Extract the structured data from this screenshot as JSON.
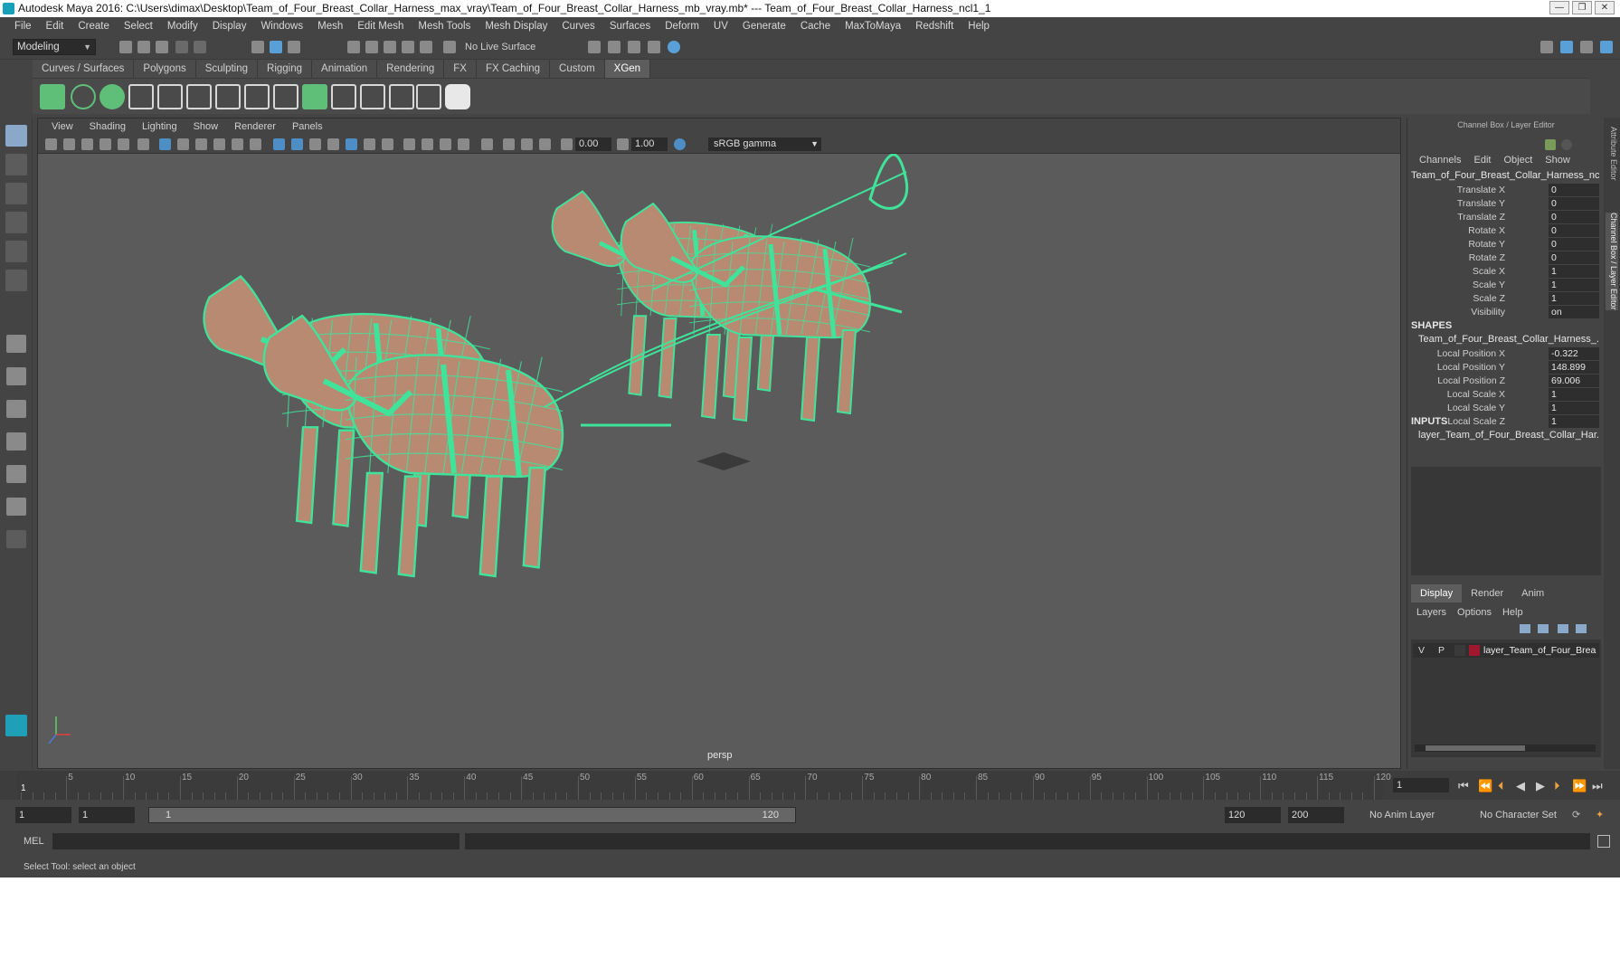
{
  "window": {
    "title": "Autodesk Maya 2016: C:\\Users\\dimax\\Desktop\\Team_of_Four_Breast_Collar_Harness_max_vray\\Team_of_Four_Breast_Collar_Harness_mb_vray.mb*   ---   Team_of_Four_Breast_Collar_Harness_ncl1_1",
    "buttons": [
      "—",
      "❐",
      "✕"
    ]
  },
  "menubar": [
    "File",
    "Edit",
    "Create",
    "Select",
    "Modify",
    "Display",
    "Windows",
    "Mesh",
    "Edit Mesh",
    "Mesh Tools",
    "Mesh Display",
    "Curves",
    "Surfaces",
    "Deform",
    "UV",
    "Generate",
    "Cache",
    "MaxToMaya",
    "Redshift",
    "Help"
  ],
  "statusline": {
    "mode": "Modeling",
    "live_surface": "No Live Surface"
  },
  "shelf": {
    "tabs": [
      "Curves / Surfaces",
      "Polygons",
      "Sculpting",
      "Rigging",
      "Animation",
      "Rendering",
      "FX",
      "FX Caching",
      "Custom",
      "XGen"
    ],
    "active_tab": "XGen"
  },
  "viewport": {
    "menu": [
      "View",
      "Shading",
      "Lighting",
      "Show",
      "Renderer",
      "Panels"
    ],
    "exposure": "0.00",
    "gamma": "1.00",
    "color_space": "sRGB gamma",
    "camera": "persp",
    "wire_color": "#3fe39a",
    "body_color": "#b98a72"
  },
  "channel_box": {
    "header": "Channel Box / Layer Editor",
    "menu": [
      "Channels",
      "Edit",
      "Object",
      "Show"
    ],
    "object_name": "Team_of_Four_Breast_Collar_Harness_ncl...",
    "channels": [
      {
        "label": "Translate X",
        "value": "0"
      },
      {
        "label": "Translate Y",
        "value": "0"
      },
      {
        "label": "Translate Z",
        "value": "0"
      },
      {
        "label": "Rotate X",
        "value": "0"
      },
      {
        "label": "Rotate Y",
        "value": "0"
      },
      {
        "label": "Rotate Z",
        "value": "0"
      },
      {
        "label": "Scale X",
        "value": "1"
      },
      {
        "label": "Scale Y",
        "value": "1"
      },
      {
        "label": "Scale Z",
        "value": "1"
      },
      {
        "label": "Visibility",
        "value": "on"
      }
    ],
    "shapes_title": "SHAPES",
    "shape_name": "Team_of_Four_Breast_Collar_Harness_...",
    "shape_channels": [
      {
        "label": "Local Position X",
        "value": "-0.322"
      },
      {
        "label": "Local Position Y",
        "value": "148.899"
      },
      {
        "label": "Local Position Z",
        "value": "69.006"
      },
      {
        "label": "Local Scale X",
        "value": "1"
      },
      {
        "label": "Local Scale Y",
        "value": "1"
      },
      {
        "label": "Local Scale Z",
        "value": "1"
      }
    ],
    "inputs_title": "INPUTS",
    "input_name": "layer_Team_of_Four_Breast_Collar_Har..."
  },
  "layer_editor": {
    "tabs": [
      "Display",
      "Render",
      "Anim"
    ],
    "active_tab": "Display",
    "menu": [
      "Layers",
      "Options",
      "Help"
    ],
    "layer": {
      "v": "V",
      "p": "P",
      "name": "layer_Team_of_Four_Brea",
      "color": "#a01830"
    }
  },
  "side_tabs": [
    "Attribute Editor",
    "Channel Box / Layer Editor"
  ],
  "timeline": {
    "ticks": [
      "5",
      "10",
      "15",
      "20",
      "25",
      "30",
      "35",
      "40",
      "45",
      "50",
      "55",
      "60",
      "65",
      "70",
      "75",
      "80",
      "85",
      "90",
      "95",
      "100",
      "105",
      "110",
      "115",
      "120"
    ],
    "current_frame_marker": "1",
    "current_frame": "1",
    "start": 1,
    "end": 120
  },
  "range": {
    "start_field": "1",
    "playback_start": "1",
    "slider_start": "1",
    "slider_end": "120",
    "playback_end": "120",
    "end_field": "200",
    "anim_layer": "No Anim Layer",
    "char_set": "No Character Set"
  },
  "command_line": {
    "label": "MEL"
  },
  "help_line": "Select Tool: select an object"
}
